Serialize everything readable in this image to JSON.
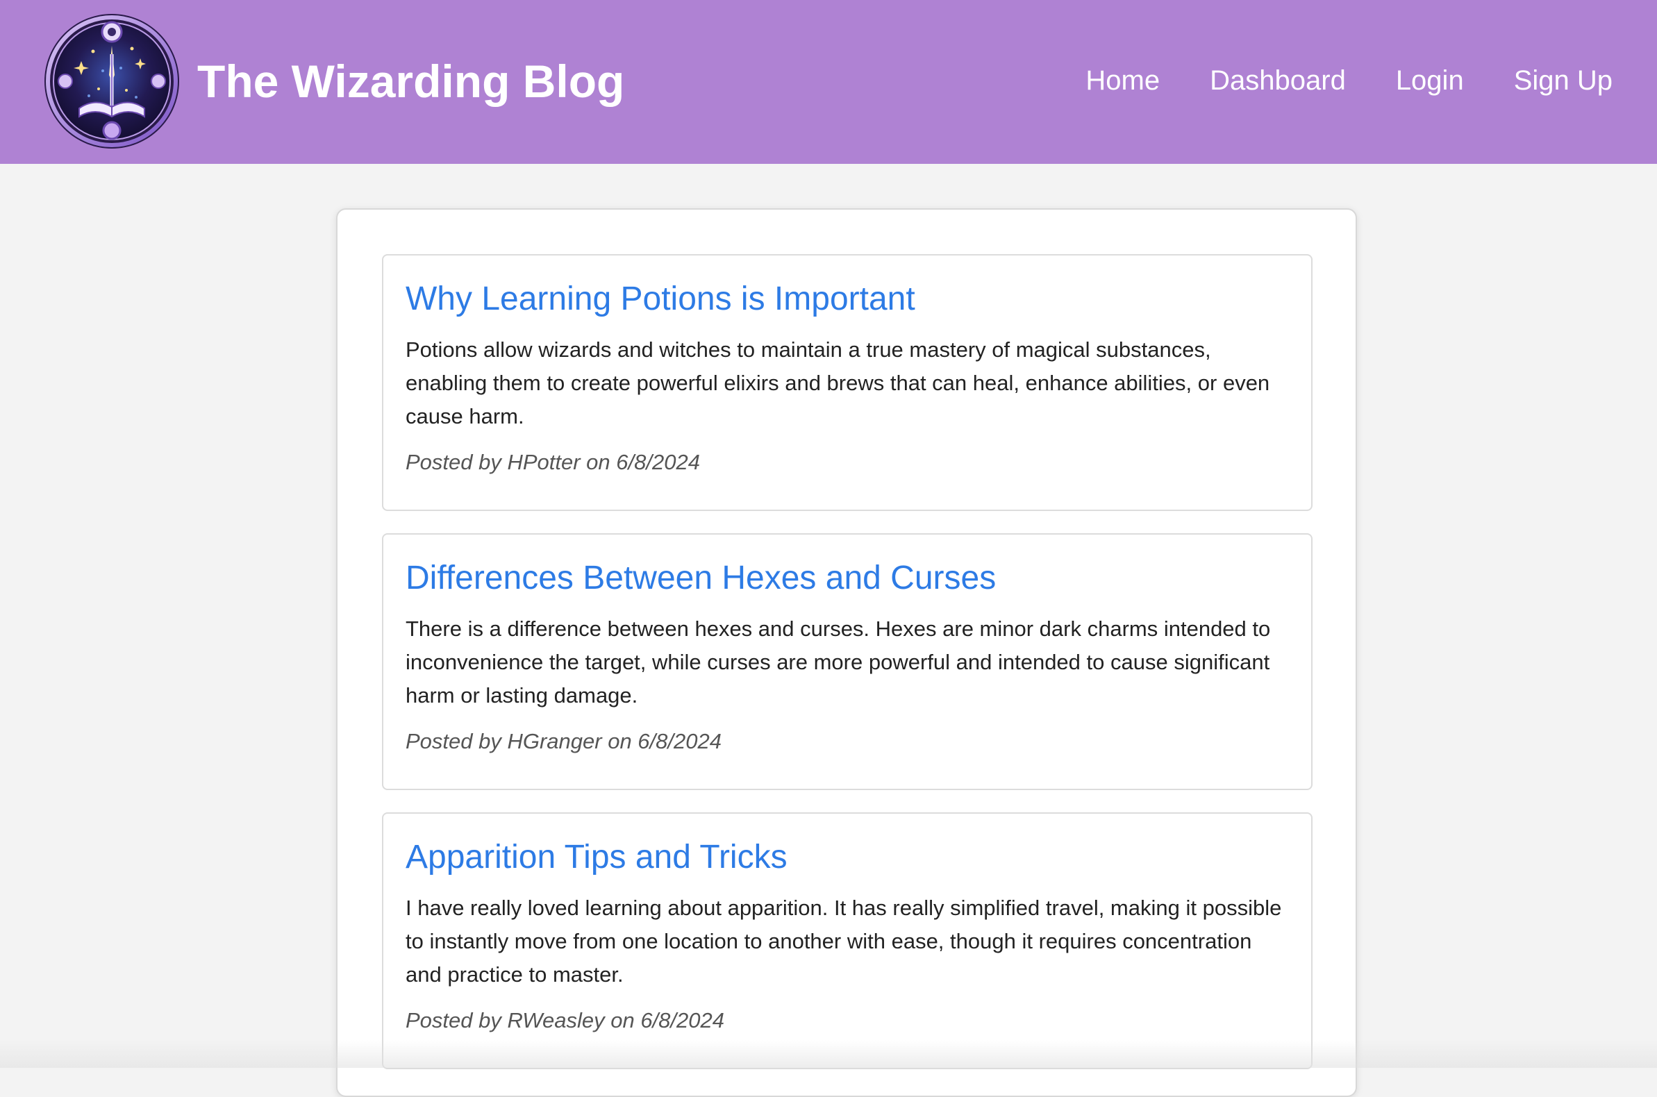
{
  "header": {
    "title": "The Wizarding Blog",
    "logo_icon": "wizard-book-wand-icon",
    "background_color": "#af82d3"
  },
  "nav": {
    "items": [
      {
        "label": "Home"
      },
      {
        "label": "Dashboard"
      },
      {
        "label": "Login"
      },
      {
        "label": "Sign Up"
      }
    ]
  },
  "posts": [
    {
      "title": "Why Learning Potions is Important",
      "body": "Potions allow wizards and witches to maintain a true mastery of magical substances, enabling them to create powerful elixirs and brews that can heal, enhance abilities, or even cause harm.",
      "meta": "Posted by HPotter on 6/8/2024"
    },
    {
      "title": "Differences Between Hexes and Curses",
      "body": "There is a difference between hexes and curses. Hexes are minor dark charms intended to inconvenience the target, while curses are more powerful and intended to cause significant harm or lasting damage.",
      "meta": "Posted by HGranger on 6/8/2024"
    },
    {
      "title": "Apparition Tips and Tricks",
      "body": "I have really loved learning about apparition. It has really simplified travel, making it possible to instantly move from one location to another with ease, though it requires concentration and practice to master.",
      "meta": "Posted by RWeasley on 6/8/2024"
    }
  ],
  "colors": {
    "link": "#2d7be5",
    "page_background": "#f3f3f3"
  }
}
